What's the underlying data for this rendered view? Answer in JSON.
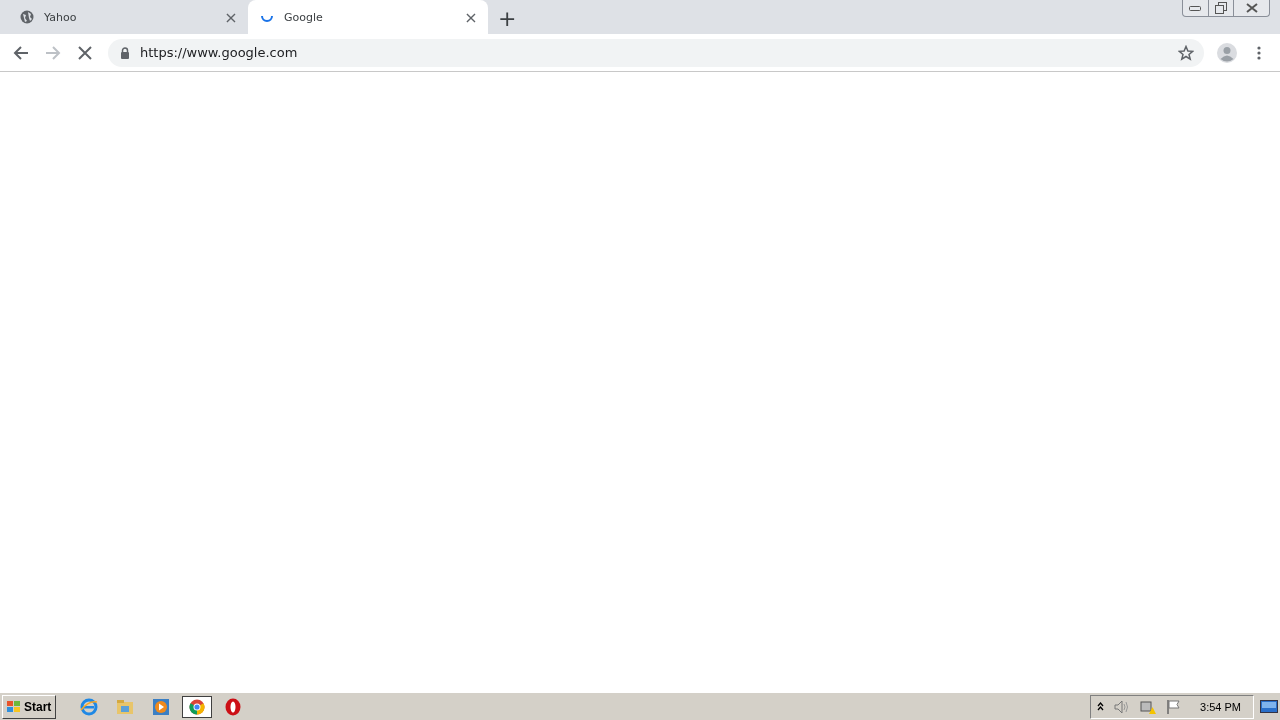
{
  "tabs": [
    {
      "title": "Yahoo",
      "selected": false,
      "kind": "globe",
      "close": "×"
    },
    {
      "title": "Google",
      "selected": true,
      "kind": "loading",
      "close": "×"
    }
  ],
  "new_tab": "+",
  "toolbar": {
    "back_enabled": true,
    "forward_enabled": false,
    "url": "https://www.google.com"
  },
  "taskbar": {
    "start": "Start",
    "apps": [
      {
        "kind": "ie",
        "selected": false
      },
      {
        "kind": "explorer",
        "selected": false
      },
      {
        "kind": "media",
        "selected": false
      },
      {
        "kind": "chrome",
        "selected": true
      },
      {
        "kind": "opera",
        "selected": false
      }
    ],
    "clock": "3:54 PM"
  }
}
